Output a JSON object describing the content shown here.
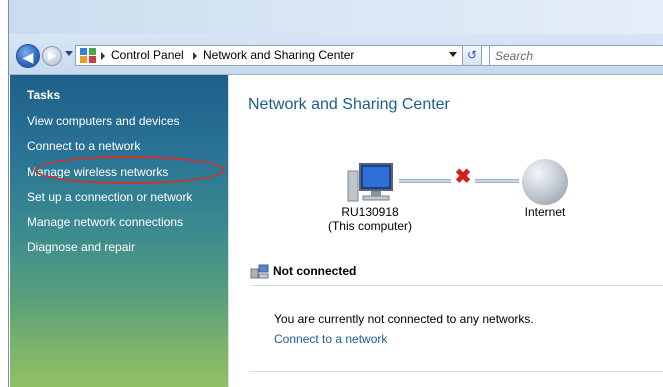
{
  "address_bar": {
    "crumbs": [
      "Control Panel",
      "Network and Sharing Center"
    ],
    "search_placeholder": "Search"
  },
  "sidebar": {
    "title": "Tasks",
    "links": [
      "View computers and devices",
      "Connect to a network",
      "Manage wireless networks",
      "Set up a connection or network",
      "Manage network connections",
      "Diagnose and repair"
    ],
    "highlighted_link": "Manage wireless networks"
  },
  "main": {
    "title": "Network and Sharing Center",
    "computer_name": "RU130918",
    "computer_note": "(This computer)",
    "internet_label": "Internet",
    "status_title": "Not connected",
    "status_text": "You are currently not connected to any networks.",
    "status_link": "Connect to a network"
  },
  "icons": {
    "back": "back-arrow-icon",
    "forward": "forward-arrow-icon",
    "control_panel": "control-panel-icon",
    "refresh": "refresh-icon",
    "computer": "computer-icon",
    "disconnected": "red-x-icon",
    "internet": "globe-icon",
    "network_status": "network-status-icon"
  },
  "colors": {
    "sidebar_top": "#1e5f8a",
    "sidebar_bottom": "#8ec064",
    "link_blue": "#1c5d8e",
    "highlight_red": "#d2332e",
    "error_red": "#d41f1f"
  }
}
